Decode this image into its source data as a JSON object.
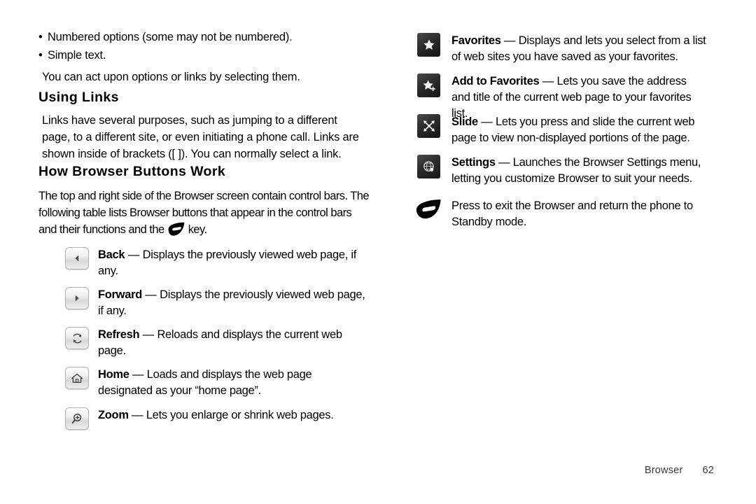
{
  "document": {
    "footer": {
      "chapter": "Browser",
      "page_number": "62"
    }
  },
  "left_column": {
    "bullets": [
      "Numbered options (some may not be numbered).",
      "Simple text."
    ],
    "intro_paragraph": "You can act upon options or links by selecting them.",
    "heading_using_links": "Using Links",
    "using_links_paragraph": "Links have several purposes, such as jumping to a different page, to a different site, or even initiating a phone call. Links are shown inside of brackets ([   ]). You can normally select a link.",
    "heading_how_browser_buttons_work": "How Browser Buttons Work",
    "control_bars_paragraph_part1": "The top and right side of the Browser screen contain control bars. The following table lists Browser buttons that appear in the control bars and their functions and the",
    "control_bars_paragraph_part2": "key.",
    "buttons": [
      {
        "icon": "back-arrow-icon",
        "label": "Back",
        "dash": "—",
        "description": "Displays the previously viewed web page, if any."
      },
      {
        "icon": "forward-arrow-icon",
        "label": "Forward",
        "dash": "—",
        "description": "Displays the previously viewed web page, if any."
      },
      {
        "icon": "refresh-icon",
        "label": "Refresh",
        "dash": "—",
        "description": "Reloads and displays the current web page."
      },
      {
        "icon": "home-icon",
        "label": "Home",
        "dash": "—",
        "description": "Loads and displays the web page designated as your “home page”."
      },
      {
        "icon": "zoom-in-icon",
        "label": "Zoom",
        "dash": "—",
        "description": "Lets you enlarge or shrink web pages."
      }
    ]
  },
  "right_column": {
    "buttons": [
      {
        "icon": "star-icon",
        "label": "Favorites",
        "dash": "—",
        "description": "Displays and lets you select from a list of web sites you have saved as your favorites."
      },
      {
        "icon": "star-plus-icon",
        "label": "Add to Favorites",
        "dash": "—",
        "description": "Lets you save the address and title of the current web page to your favorites list."
      },
      {
        "icon": "four-way-arrow-icon",
        "label": "Slide",
        "dash": "—",
        "description": "Lets you press and slide the current web page to view non-displayed portions of the page."
      },
      {
        "icon": "globe-settings-icon",
        "label": "Settings",
        "dash": "—",
        "description": "Launches the Browser Settings menu, letting you customize Browser to suit your needs."
      },
      {
        "icon": "end-key-icon",
        "label": "",
        "dash": "",
        "description": "Press to exit the Browser and return the phone to Standby mode."
      }
    ]
  }
}
